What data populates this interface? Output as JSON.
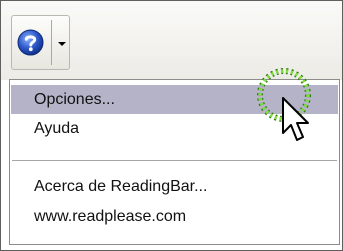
{
  "toolbar": {
    "help_button": {
      "icon": "help-icon",
      "dropdown_icon": "chevron-down-icon"
    }
  },
  "menu": {
    "items": [
      {
        "label": "Opciones...",
        "highlighted": true
      },
      {
        "label": "Ayuda"
      },
      {
        "label": "Acerca de ReadingBar..."
      },
      {
        "label": "www.readplease.com"
      }
    ]
  },
  "colors": {
    "highlight": "#b4b3c8",
    "click_ring": "#5fc21a",
    "help_blue": "#2b57c8"
  },
  "cursor": {
    "icon": "mouse-pointer-icon",
    "click_indicator": true
  }
}
